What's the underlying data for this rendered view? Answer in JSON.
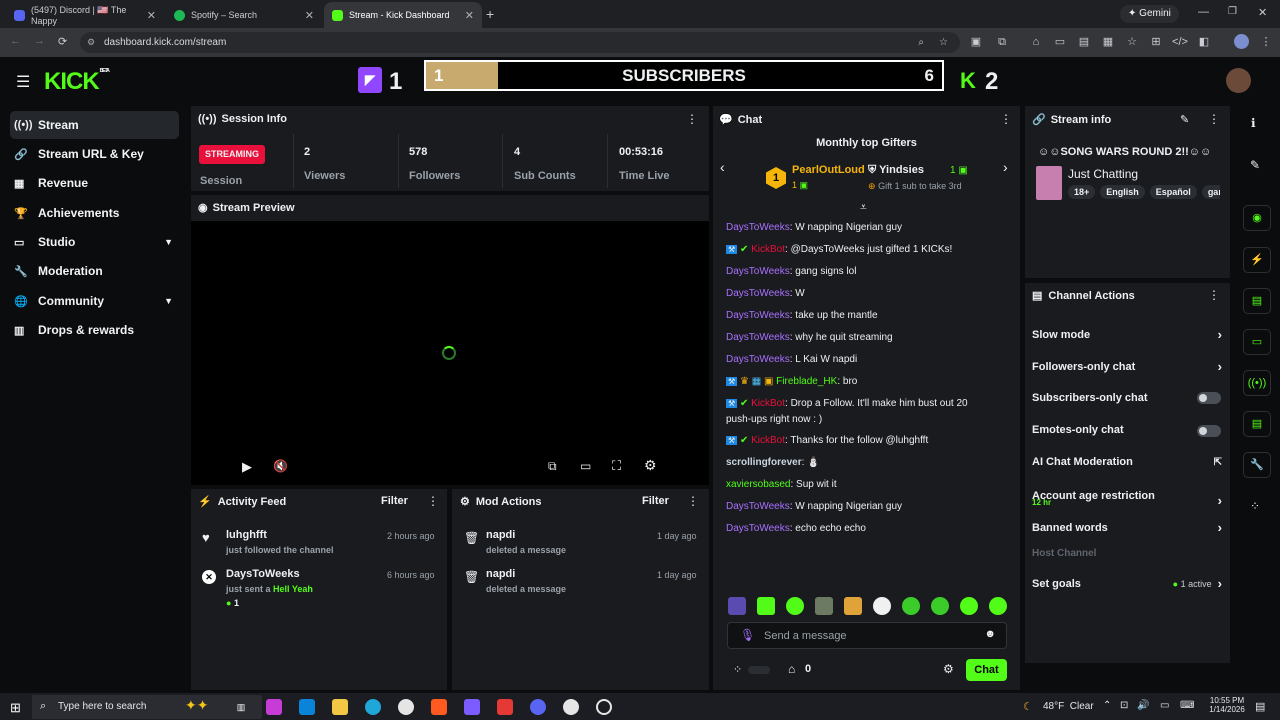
{
  "browser": {
    "tabs": [
      {
        "title": "(5497) Discord | 🇺🇸 The Nappy"
      },
      {
        "title": "Spotify – Search"
      },
      {
        "title": "Stream - Kick Dashboard"
      }
    ],
    "url": "dashboard.kick.com/stream",
    "gemini_label": "Gemini"
  },
  "header": {
    "logo": "KICK",
    "logo_badge": "BETA",
    "twitch_score": "1",
    "kick_score": "2",
    "sub_bar": {
      "left_count": "1",
      "label": "SUBSCRIBERS",
      "right_count": "6",
      "progress": 0.14
    }
  },
  "sidebar": {
    "items": [
      {
        "label": "Stream"
      },
      {
        "label": "Stream URL & Key"
      },
      {
        "label": "Revenue"
      },
      {
        "label": "Achievements"
      },
      {
        "label": "Studio"
      },
      {
        "label": "Moderation"
      },
      {
        "label": "Community"
      },
      {
        "label": "Drops & rewards"
      }
    ]
  },
  "session": {
    "title": "Session Info",
    "badge": "STREAMING",
    "session_label": "Session",
    "stats": [
      {
        "value": "2",
        "label": "Viewers"
      },
      {
        "value": "578",
        "label": "Followers"
      },
      {
        "value": "4",
        "label": "Sub Counts"
      },
      {
        "value": "00:53:16",
        "label": "Time Live"
      }
    ]
  },
  "preview": {
    "title": "Stream Preview"
  },
  "activity": {
    "title": "Activity Feed",
    "filter": "Filter",
    "items": [
      {
        "user": "luhghfft",
        "action": "just followed the channel",
        "time": "2 hours ago"
      },
      {
        "user": "DaysToWeeks",
        "action": "just sent a",
        "highlight": "Hell Yeah",
        "count": "1",
        "time": "6 hours ago"
      }
    ]
  },
  "mod_actions": {
    "title": "Mod Actions",
    "filter": "Filter",
    "items": [
      {
        "user": "napdi",
        "action": "deleted a message",
        "time": "1 day ago"
      },
      {
        "user": "napdi",
        "action": "deleted a message",
        "time": "1 day ago"
      }
    ]
  },
  "chat": {
    "title": "Chat",
    "gifters_title": "Monthly top Gifters",
    "gifter1": {
      "rank": "1",
      "name": "PearlOutLoud",
      "count": "1"
    },
    "gifter2": {
      "name": "Yindsies",
      "count": "1",
      "note": "Gift 1 sub to take 3rd"
    },
    "messages": [
      {
        "user": "DaysToWeeks",
        "text": ": W napping Nigerian guy"
      },
      {
        "user": "KickBot",
        "text": ": @DaysToWeeks just gifted 1 KICKs!"
      },
      {
        "user": "DaysToWeeks",
        "text": ": gang signs lol"
      },
      {
        "user": "DaysToWeeks",
        "text": ": W"
      },
      {
        "user": "DaysToWeeks",
        "text": ": take up the mantle"
      },
      {
        "user": "DaysToWeeks",
        "text": ": why he quit streaming"
      },
      {
        "user": "DaysToWeeks",
        "text": ": L Kai W napdi"
      },
      {
        "user": "Fireblade_HK",
        "text": ": bro"
      },
      {
        "user": "KickBot",
        "text": ": Drop a Follow. It'll make him bust out 20"
      },
      {
        "user": "",
        "text": "push-ups right now : )"
      },
      {
        "user": "KickBot",
        "text": ": Thanks for the follow @luhghfft"
      },
      {
        "user": "scrollingforever",
        "text": ":"
      },
      {
        "user": "xaviersobased",
        "text": ": Sup wit it"
      },
      {
        "user": "DaysToWeeks",
        "text": ": W napping Nigerian guy"
      },
      {
        "user": "DaysToWeeks",
        "text": ": echo echo echo"
      }
    ],
    "input_placeholder": "Send a message",
    "points": "0",
    "send_label": "Chat"
  },
  "stream_info": {
    "title": "Stream info",
    "stream_title": "☺☺SONG WARS ROUND 2!!☺☺",
    "category": "Just Chatting",
    "tags": [
      "18+",
      "English",
      "Español",
      "gar"
    ]
  },
  "channel_actions": {
    "title": "Channel Actions",
    "slow_mode": "Slow mode",
    "followers_only": "Followers-only chat",
    "subscribers_only": "Subscribers-only chat",
    "emotes_only": "Emotes-only chat",
    "ai_moderation": "AI Chat Moderation",
    "account_age": "Account age restriction",
    "account_age_value": "12 hr",
    "banned_words": "Banned words",
    "host_channel": "Host Channel",
    "set_goals": "Set goals",
    "set_goals_status": "1 active"
  },
  "taskbar": {
    "search_placeholder": "Type here to search",
    "weather": "48°F  Clear",
    "time": "10:55 PM",
    "date": "1/14/2026"
  },
  "colors": {
    "accent": "#53fc18",
    "streaming": "#e9113c",
    "chat_user": "#a970ff",
    "gold": "#c8a96e"
  }
}
